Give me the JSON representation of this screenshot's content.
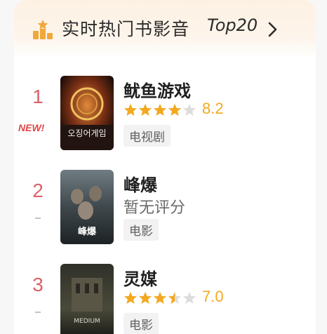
{
  "header": {
    "title": "实时热门书影音",
    "tag": "Top20",
    "icon": "trophy-bars-icon",
    "chevron_icon": "chevron-right-icon"
  },
  "items": [
    {
      "rank": "1",
      "badge": "NEW!",
      "title": "鱿鱼游戏",
      "rating": 8.2,
      "rating_text": "8.2",
      "stars_fraction": 0.8,
      "category": "电视剧",
      "poster_text": "오징어게임"
    },
    {
      "rank": "2",
      "title": "峰爆",
      "rating_text": "暂无评分",
      "category": "电影",
      "poster_text": "峰爆"
    },
    {
      "rank": "3",
      "title": "灵媒",
      "rating": 7.0,
      "rating_text": "7.0",
      "stars_fraction": 0.7,
      "category": "电影",
      "poster_text": "MEDIUM"
    }
  ],
  "colors": {
    "rank": "#d9636b",
    "star": "#f3a91f",
    "star_empty": "#dddddd",
    "new_badge": "#e24646",
    "header_bg": "#fdf1e3"
  }
}
